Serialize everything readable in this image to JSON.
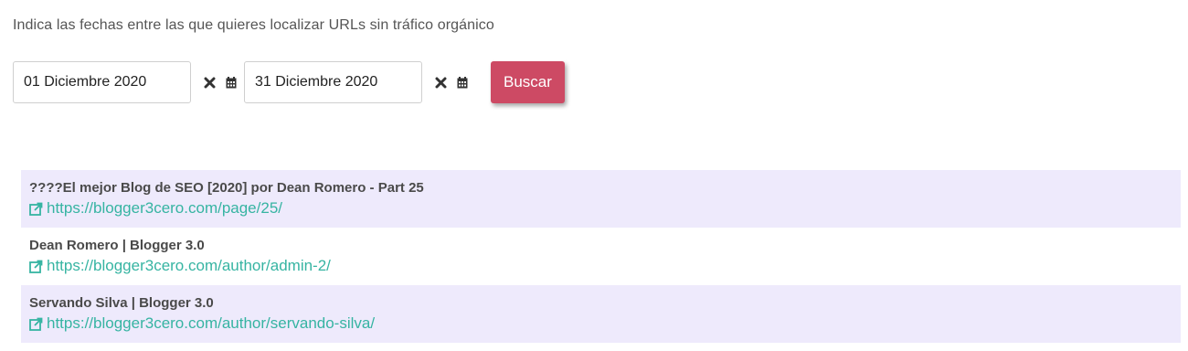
{
  "instruction": "Indica las fechas entre las que quieres localizar URLs sin tráfico orgánico",
  "filters": {
    "start_date": "01 Diciembre 2020",
    "end_date": "31 Diciembre 2020",
    "clear_icon": "close-icon",
    "calendar_icon": "calendar-icon",
    "search_label": "Buscar"
  },
  "colors": {
    "accent_button": "#cd4a64",
    "link": "#36b4a2",
    "row_shade": "#eeeafc"
  },
  "results": [
    {
      "title": "????El mejor Blog de SEO [2020] por Dean Romero - Part 25",
      "url": "https://blogger3cero.com/page/25/"
    },
    {
      "title": "Dean Romero | Blogger 3.0",
      "url": "https://blogger3cero.com/author/admin-2/"
    },
    {
      "title": "Servando Silva | Blogger 3.0",
      "url": "https://blogger3cero.com/author/servando-silva/"
    }
  ]
}
